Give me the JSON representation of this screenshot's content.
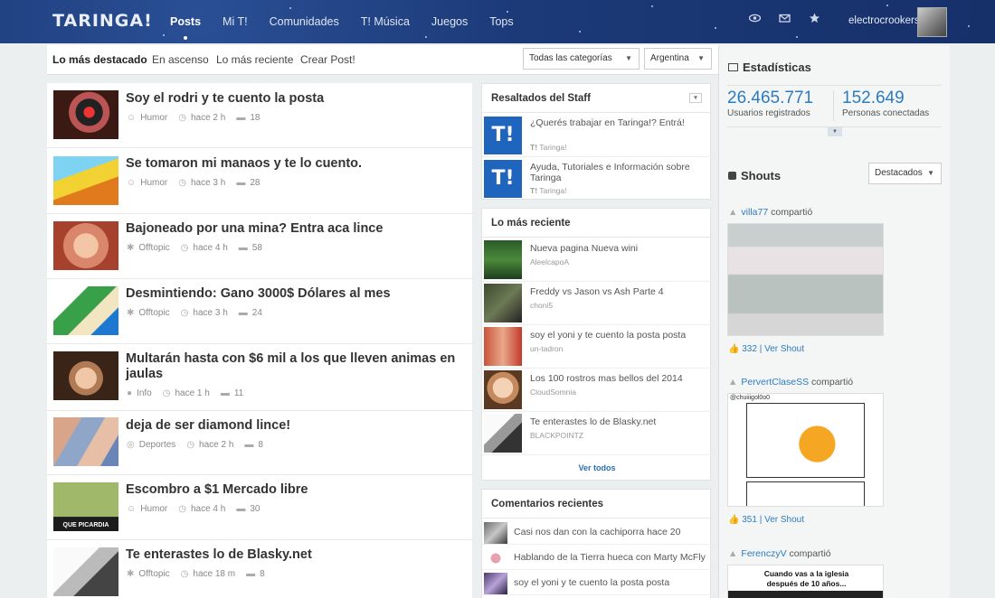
{
  "header": {
    "logo": "TARINGA!",
    "nav": [
      "Posts",
      "Mi T!",
      "Comunidades",
      "T! Música",
      "Juegos",
      "Tops"
    ],
    "icons": [
      "eye-icon",
      "mail-icon",
      "star-icon"
    ],
    "username": "electrocrookers"
  },
  "tabs": {
    "items": [
      "Lo más destacado",
      "En ascenso",
      "Lo más reciente",
      "Crear Post!"
    ],
    "category_select": "Todas las categorías",
    "country_select": "Argentina"
  },
  "posts": [
    {
      "title": "Soy el rodri y te cuento la posta",
      "category": "Humor",
      "time": "hace 2 h",
      "comments": "18"
    },
    {
      "title": "Se tomaron mi manaos y te lo cuento.",
      "category": "Humor",
      "time": "hace 3 h",
      "comments": "28"
    },
    {
      "title": "Bajoneado por una mina? Entra aca lince",
      "category": "Offtopic",
      "time": "hace 4 h",
      "comments": "58"
    },
    {
      "title": "Desmintiendo: Gano 3000$ Dólares al mes",
      "category": "Offtopic",
      "time": "hace 3 h",
      "comments": "24"
    },
    {
      "title": "Multarán hasta con $6 mil a los que lleven animas en jaulas",
      "category": "Info",
      "time": "hace 1 h",
      "comments": "11"
    },
    {
      "title": "deja de ser diamond lince!",
      "category": "Deportes",
      "time": "hace 2 h",
      "comments": "8"
    },
    {
      "title": "Escombro a $1 Mercado libre",
      "category": "Humor",
      "time": "hace 4 h",
      "comments": "30"
    },
    {
      "title": "Te enterastes lo de Blasky.net",
      "category": "Offtopic",
      "time": "hace 18 m",
      "comments": "8"
    }
  ],
  "thumb_texts": {
    "picardia": "QUE PICARDIA"
  },
  "staff": {
    "title": "Resaltados del Staff",
    "items": [
      {
        "logo": "T!",
        "text": "¿Querés trabajar en Taringa!? Entrá!",
        "source": "Taringa!"
      },
      {
        "logo": "T!",
        "text": "Ayuda, Tutoriales e Información sobre Taringa",
        "source": "Taringa!"
      }
    ],
    "source_prefix": "T!"
  },
  "recent": {
    "title": "Lo más reciente",
    "items": [
      {
        "title": "Nueva pagina Nueva wini",
        "user": "AleelcapoA"
      },
      {
        "title": "Freddy vs Jason vs Ash Parte 4",
        "user": "choni5"
      },
      {
        "title": "soy el yoni y te cuento la posta posta",
        "user": "un-tadron"
      },
      {
        "title": "Los 100 rostros mas bellos del 2014",
        "user": "CloudSomnia"
      },
      {
        "title": "Te enterastes lo de Blasky.net",
        "user": "BLACKPOINTZ"
      }
    ],
    "see_all": "Ver todos"
  },
  "comments": {
    "title": "Comentarios recientes",
    "items": [
      "Casi nos dan con la cachiporra hace 20",
      "Hablando de la Tierra hueca con Marty McFly",
      "soy el yoni y te cuento la posta posta"
    ]
  },
  "stats": {
    "title": "Estadísticas",
    "users_value": "26.465.771",
    "users_label": "Usuarios registrados",
    "online_value": "152.649",
    "online_label": "Personas conectadas"
  },
  "shouts": {
    "title": "Shouts",
    "filter": "Destacados",
    "items": [
      {
        "user": "villa77",
        "action": "compartió",
        "likes": "332",
        "link": "Ver Shout"
      },
      {
        "user": "PervertClaseSS",
        "action": "compartió",
        "likes": "351",
        "link": "Ver Shout",
        "img_caption": "@chuiiigol0o0"
      },
      {
        "user": "FerenczyV",
        "action": "compartió",
        "img_caption": "Cuando vas a la iglesia después de 10 años..."
      }
    ]
  },
  "colors": {
    "brand_blue": "#1c3a78",
    "link_blue": "#2d7bbf",
    "taringa_blue": "#1f64bd"
  }
}
